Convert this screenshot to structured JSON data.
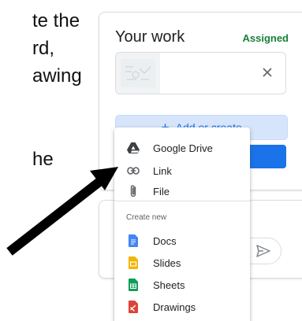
{
  "instruction": {
    "line1": "te the",
    "line2": "rd,",
    "line3": "awing",
    "line4": "he"
  },
  "work_card": {
    "title": "Your work",
    "status": "Assigned",
    "add_button_label": "Add or create"
  },
  "menu": {
    "items": [
      {
        "label": "Google Drive",
        "icon": "google-drive-icon"
      },
      {
        "label": "Link",
        "icon": "link-icon"
      },
      {
        "label": "File",
        "icon": "paperclip-icon"
      }
    ],
    "section_title": "Create new",
    "create_items": [
      {
        "label": "Docs",
        "icon": "docs-icon",
        "color": "#4285f4"
      },
      {
        "label": "Slides",
        "icon": "slides-icon",
        "color": "#f4b400"
      },
      {
        "label": "Sheets",
        "icon": "sheets-icon",
        "color": "#0f9d58"
      },
      {
        "label": "Drawings",
        "icon": "drawings-icon",
        "color": "#db4437"
      }
    ]
  },
  "colors": {
    "assigned_green": "#188038",
    "accent_blue": "#1a73e8",
    "add_button_bg": "#d7e5fb",
    "arrow": "#000000"
  }
}
